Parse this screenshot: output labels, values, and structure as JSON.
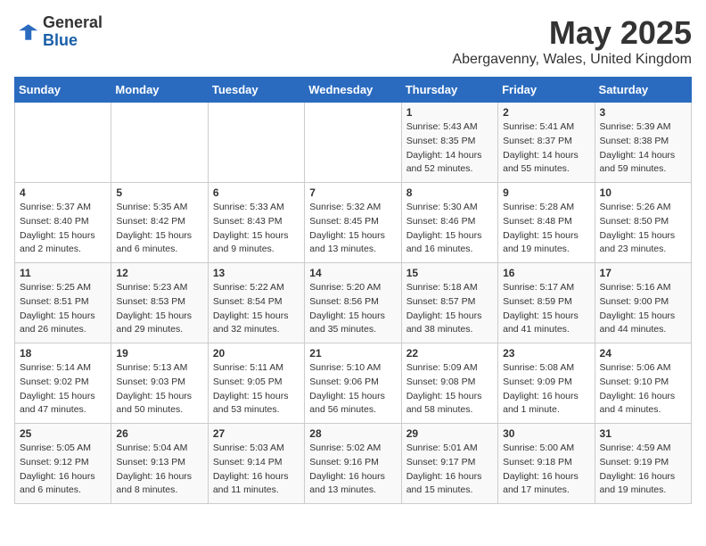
{
  "header": {
    "logo": {
      "general": "General",
      "blue": "Blue"
    },
    "title": "May 2025",
    "location": "Abergavenny, Wales, United Kingdom"
  },
  "weekdays": [
    "Sunday",
    "Monday",
    "Tuesday",
    "Wednesday",
    "Thursday",
    "Friday",
    "Saturday"
  ],
  "weeks": [
    [
      {
        "day": "",
        "sunrise": "",
        "sunset": "",
        "daylight": ""
      },
      {
        "day": "",
        "sunrise": "",
        "sunset": "",
        "daylight": ""
      },
      {
        "day": "",
        "sunrise": "",
        "sunset": "",
        "daylight": ""
      },
      {
        "day": "",
        "sunrise": "",
        "sunset": "",
        "daylight": ""
      },
      {
        "day": "1",
        "sunrise": "Sunrise: 5:43 AM",
        "sunset": "Sunset: 8:35 PM",
        "daylight": "Daylight: 14 hours and 52 minutes."
      },
      {
        "day": "2",
        "sunrise": "Sunrise: 5:41 AM",
        "sunset": "Sunset: 8:37 PM",
        "daylight": "Daylight: 14 hours and 55 minutes."
      },
      {
        "day": "3",
        "sunrise": "Sunrise: 5:39 AM",
        "sunset": "Sunset: 8:38 PM",
        "daylight": "Daylight: 14 hours and 59 minutes."
      }
    ],
    [
      {
        "day": "4",
        "sunrise": "Sunrise: 5:37 AM",
        "sunset": "Sunset: 8:40 PM",
        "daylight": "Daylight: 15 hours and 2 minutes."
      },
      {
        "day": "5",
        "sunrise": "Sunrise: 5:35 AM",
        "sunset": "Sunset: 8:42 PM",
        "daylight": "Daylight: 15 hours and 6 minutes."
      },
      {
        "day": "6",
        "sunrise": "Sunrise: 5:33 AM",
        "sunset": "Sunset: 8:43 PM",
        "daylight": "Daylight: 15 hours and 9 minutes."
      },
      {
        "day": "7",
        "sunrise": "Sunrise: 5:32 AM",
        "sunset": "Sunset: 8:45 PM",
        "daylight": "Daylight: 15 hours and 13 minutes."
      },
      {
        "day": "8",
        "sunrise": "Sunrise: 5:30 AM",
        "sunset": "Sunset: 8:46 PM",
        "daylight": "Daylight: 15 hours and 16 minutes."
      },
      {
        "day": "9",
        "sunrise": "Sunrise: 5:28 AM",
        "sunset": "Sunset: 8:48 PM",
        "daylight": "Daylight: 15 hours and 19 minutes."
      },
      {
        "day": "10",
        "sunrise": "Sunrise: 5:26 AM",
        "sunset": "Sunset: 8:50 PM",
        "daylight": "Daylight: 15 hours and 23 minutes."
      }
    ],
    [
      {
        "day": "11",
        "sunrise": "Sunrise: 5:25 AM",
        "sunset": "Sunset: 8:51 PM",
        "daylight": "Daylight: 15 hours and 26 minutes."
      },
      {
        "day": "12",
        "sunrise": "Sunrise: 5:23 AM",
        "sunset": "Sunset: 8:53 PM",
        "daylight": "Daylight: 15 hours and 29 minutes."
      },
      {
        "day": "13",
        "sunrise": "Sunrise: 5:22 AM",
        "sunset": "Sunset: 8:54 PM",
        "daylight": "Daylight: 15 hours and 32 minutes."
      },
      {
        "day": "14",
        "sunrise": "Sunrise: 5:20 AM",
        "sunset": "Sunset: 8:56 PM",
        "daylight": "Daylight: 15 hours and 35 minutes."
      },
      {
        "day": "15",
        "sunrise": "Sunrise: 5:18 AM",
        "sunset": "Sunset: 8:57 PM",
        "daylight": "Daylight: 15 hours and 38 minutes."
      },
      {
        "day": "16",
        "sunrise": "Sunrise: 5:17 AM",
        "sunset": "Sunset: 8:59 PM",
        "daylight": "Daylight: 15 hours and 41 minutes."
      },
      {
        "day": "17",
        "sunrise": "Sunrise: 5:16 AM",
        "sunset": "Sunset: 9:00 PM",
        "daylight": "Daylight: 15 hours and 44 minutes."
      }
    ],
    [
      {
        "day": "18",
        "sunrise": "Sunrise: 5:14 AM",
        "sunset": "Sunset: 9:02 PM",
        "daylight": "Daylight: 15 hours and 47 minutes."
      },
      {
        "day": "19",
        "sunrise": "Sunrise: 5:13 AM",
        "sunset": "Sunset: 9:03 PM",
        "daylight": "Daylight: 15 hours and 50 minutes."
      },
      {
        "day": "20",
        "sunrise": "Sunrise: 5:11 AM",
        "sunset": "Sunset: 9:05 PM",
        "daylight": "Daylight: 15 hours and 53 minutes."
      },
      {
        "day": "21",
        "sunrise": "Sunrise: 5:10 AM",
        "sunset": "Sunset: 9:06 PM",
        "daylight": "Daylight: 15 hours and 56 minutes."
      },
      {
        "day": "22",
        "sunrise": "Sunrise: 5:09 AM",
        "sunset": "Sunset: 9:08 PM",
        "daylight": "Daylight: 15 hours and 58 minutes."
      },
      {
        "day": "23",
        "sunrise": "Sunrise: 5:08 AM",
        "sunset": "Sunset: 9:09 PM",
        "daylight": "Daylight: 16 hours and 1 minute."
      },
      {
        "day": "24",
        "sunrise": "Sunrise: 5:06 AM",
        "sunset": "Sunset: 9:10 PM",
        "daylight": "Daylight: 16 hours and 4 minutes."
      }
    ],
    [
      {
        "day": "25",
        "sunrise": "Sunrise: 5:05 AM",
        "sunset": "Sunset: 9:12 PM",
        "daylight": "Daylight: 16 hours and 6 minutes."
      },
      {
        "day": "26",
        "sunrise": "Sunrise: 5:04 AM",
        "sunset": "Sunset: 9:13 PM",
        "daylight": "Daylight: 16 hours and 8 minutes."
      },
      {
        "day": "27",
        "sunrise": "Sunrise: 5:03 AM",
        "sunset": "Sunset: 9:14 PM",
        "daylight": "Daylight: 16 hours and 11 minutes."
      },
      {
        "day": "28",
        "sunrise": "Sunrise: 5:02 AM",
        "sunset": "Sunset: 9:16 PM",
        "daylight": "Daylight: 16 hours and 13 minutes."
      },
      {
        "day": "29",
        "sunrise": "Sunrise: 5:01 AM",
        "sunset": "Sunset: 9:17 PM",
        "daylight": "Daylight: 16 hours and 15 minutes."
      },
      {
        "day": "30",
        "sunrise": "Sunrise: 5:00 AM",
        "sunset": "Sunset: 9:18 PM",
        "daylight": "Daylight: 16 hours and 17 minutes."
      },
      {
        "day": "31",
        "sunrise": "Sunrise: 4:59 AM",
        "sunset": "Sunset: 9:19 PM",
        "daylight": "Daylight: 16 hours and 19 minutes."
      }
    ]
  ]
}
